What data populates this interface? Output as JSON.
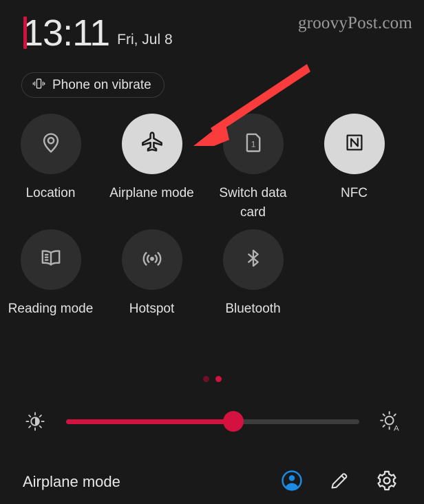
{
  "status": {
    "time": "13:11",
    "date": "Fri, Jul 8",
    "watermark": "groovyPost.com",
    "accent_color": "#d3123f"
  },
  "vibrate_chip": {
    "label": "Phone on vibrate",
    "icon": "vibrate-icon"
  },
  "quick_settings": {
    "tiles": [
      {
        "label": "Location",
        "icon": "location-pin-icon",
        "active": false
      },
      {
        "label": "Airplane mode",
        "icon": "airplane-icon",
        "active": true
      },
      {
        "label": "Switch data card",
        "icon": "sim-card-1-icon",
        "active": false
      },
      {
        "label": "NFC",
        "icon": "nfc-icon",
        "active": true
      },
      {
        "label": "Reading mode",
        "icon": "book-icon",
        "active": false
      },
      {
        "label": "Hotspot",
        "icon": "hotspot-icon",
        "active": false
      },
      {
        "label": "Bluetooth",
        "icon": "bluetooth-icon",
        "active": false
      }
    ],
    "pager": {
      "pages": 2,
      "active_index": 1,
      "active_color": "#d3123f",
      "inactive_color": "#6e1028"
    }
  },
  "brightness": {
    "left_icon": "brightness-contrast-icon",
    "right_icon": "auto-brightness-icon",
    "value_percent": 57,
    "fill_color": "#d3123f",
    "track_color": "#3d3d3d"
  },
  "footer": {
    "title": "Airplane mode",
    "actions": [
      {
        "icon": "user-account-icon",
        "color": "#1a8ae5"
      },
      {
        "icon": "edit-pencil-icon",
        "color": "#e0e0e0"
      },
      {
        "icon": "settings-gear-icon",
        "color": "#e0e0e0"
      }
    ]
  },
  "annotation": {
    "type": "arrow",
    "color": "#fa3c3c",
    "points_at": "Airplane mode"
  }
}
